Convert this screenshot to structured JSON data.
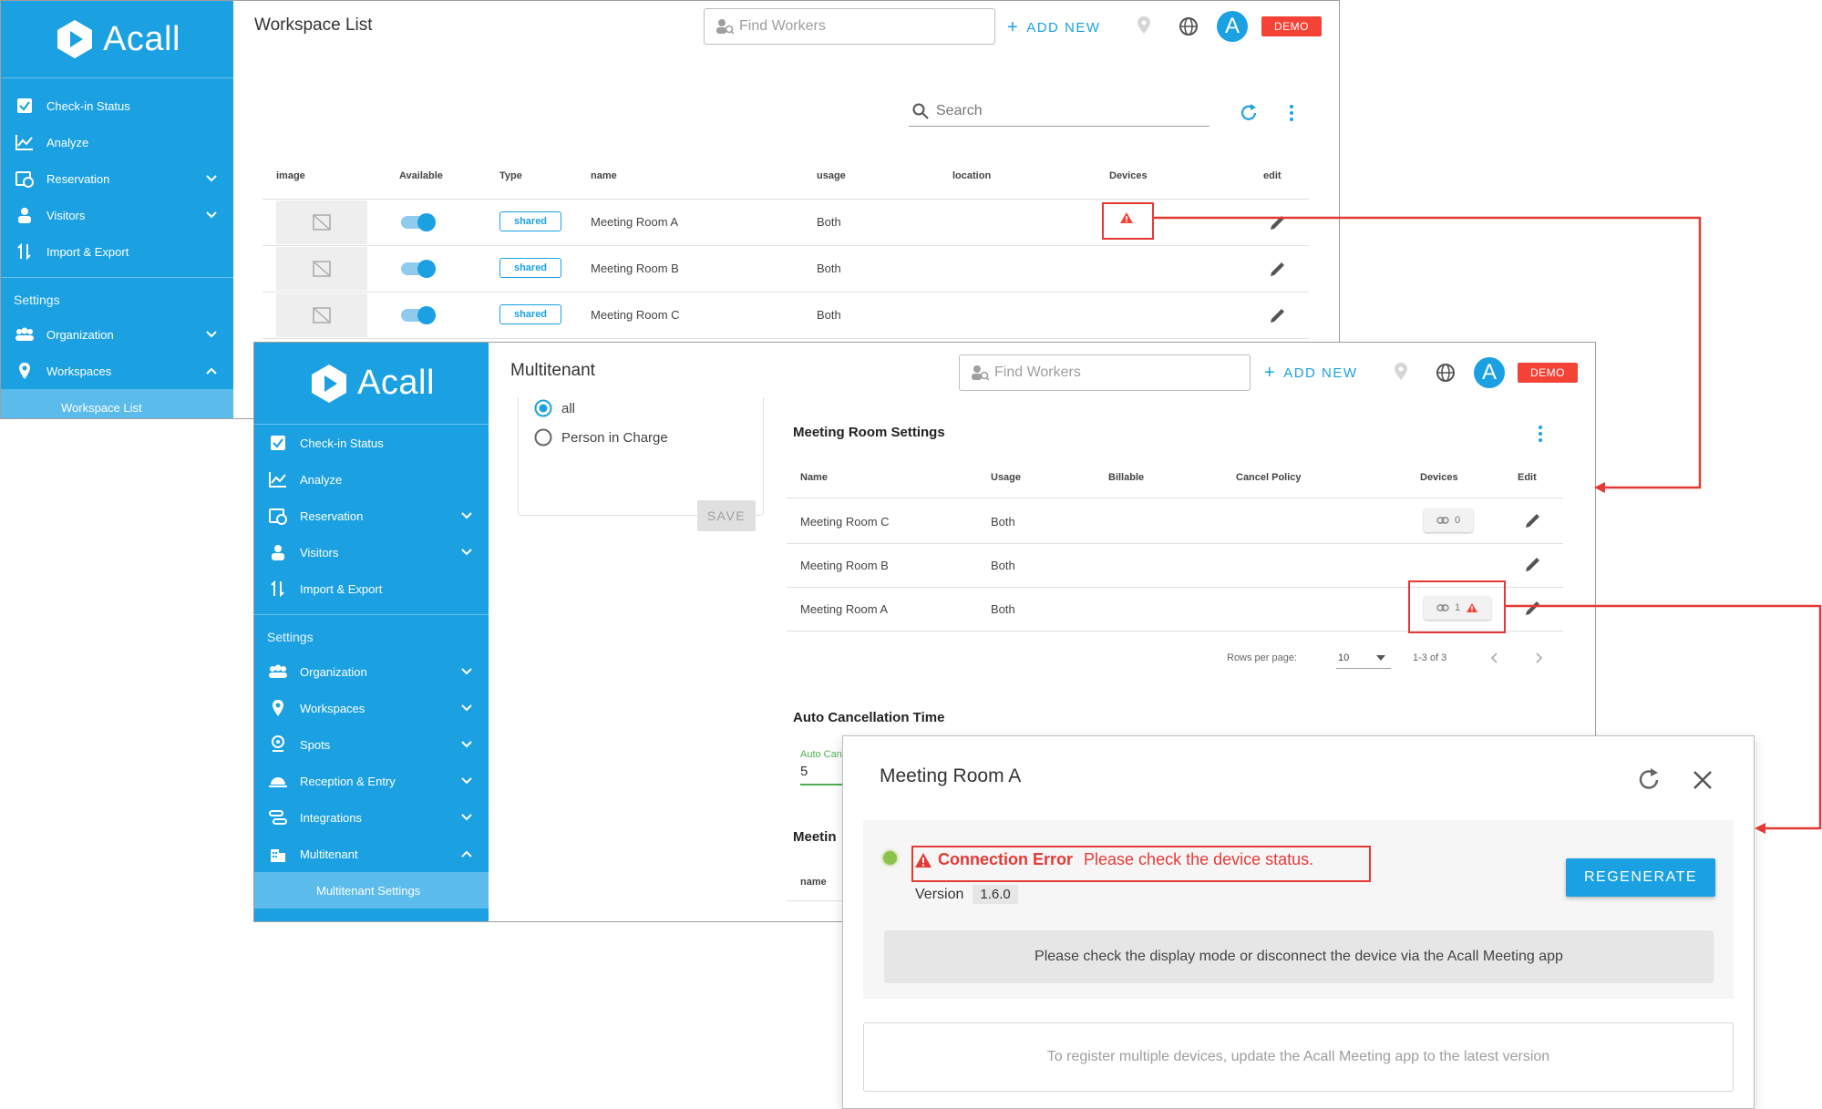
{
  "brand": {
    "name": "Acall"
  },
  "common": {
    "find_placeholder": "Find Workers",
    "add_new": "ADD NEW",
    "avatar_initial": "A",
    "demo_badge": "DEMO",
    "accent": "#1ba1e2",
    "error_color": "#f44336"
  },
  "window1": {
    "title": "Workspace List",
    "search_placeholder": "Search",
    "sidebar": {
      "items": [
        {
          "label": "Check-in Status",
          "icon": "checkbox-icon"
        },
        {
          "label": "Analyze",
          "icon": "chart-line-icon"
        },
        {
          "label": "Reservation",
          "icon": "calendar-clock-icon"
        },
        {
          "label": "Visitors",
          "icon": "visitor-icon"
        },
        {
          "label": "Import & Export",
          "icon": "import-export-icon"
        }
      ],
      "settings_label": "Settings",
      "settings_items": [
        {
          "label": "Organization",
          "icon": "people-icon"
        },
        {
          "label": "Workspaces",
          "icon": "location-pin-icon"
        }
      ],
      "active_sub": "Workspace List"
    },
    "table": {
      "headers": [
        "image",
        "Available",
        "Type",
        "name",
        "usage",
        "location",
        "Devices",
        "edit"
      ],
      "rows": [
        {
          "type": "shared",
          "name": "Meeting Room A",
          "usage": "Both",
          "available": true,
          "device_warning": true
        },
        {
          "type": "shared",
          "name": "Meeting Room B",
          "usage": "Both",
          "available": true,
          "device_warning": false
        },
        {
          "type": "shared",
          "name": "Meeting Room C",
          "usage": "Both",
          "available": true,
          "device_warning": false
        }
      ]
    }
  },
  "window2": {
    "title": "Multitenant",
    "sidebar": {
      "items": [
        {
          "label": "Check-in Status"
        },
        {
          "label": "Analyze"
        },
        {
          "label": "Reservation"
        },
        {
          "label": "Visitors"
        },
        {
          "label": "Import & Export"
        }
      ],
      "settings_label": "Settings",
      "settings_items": [
        {
          "label": "Organization"
        },
        {
          "label": "Workspaces"
        },
        {
          "label": "Spots"
        },
        {
          "label": "Reception & Entry"
        },
        {
          "label": "Integrations"
        },
        {
          "label": "Multitenant"
        }
      ],
      "active_sub": "Multitenant Settings"
    },
    "left_panel": {
      "radio_all": "all",
      "radio_person": "Person in Charge",
      "save": "SAVE"
    },
    "meeting_room_settings": {
      "title": "Meeting Room Settings",
      "headers": [
        "Name",
        "Usage",
        "Billable",
        "Cancel Policy",
        "Devices",
        "Edit"
      ],
      "rows": [
        {
          "name": "Meeting Room C",
          "usage": "Both",
          "devices": "0",
          "device_warning": false
        },
        {
          "name": "Meeting Room B",
          "usage": "Both",
          "devices": "",
          "device_warning": false
        },
        {
          "name": "Meeting Room A",
          "usage": "Both",
          "devices": "1",
          "device_warning": true
        }
      ],
      "rows_per_page_label": "Rows per page:",
      "rows_per_page_value": "10",
      "page_range": "1-3 of 3"
    },
    "auto_cancel": {
      "title": "Auto Cancellation Time",
      "field_label": "Auto Can",
      "value": "5"
    },
    "cut_heading": "Meetin",
    "cut_column": "name"
  },
  "dialog": {
    "title": "Meeting Room A",
    "error_title": "Connection Error",
    "error_message": "Please check the device status.",
    "version_label": "Version",
    "version_value": "1.6.0",
    "regenerate": "REGENERATE",
    "info_message": "Please check the display mode or disconnect the device via the Acall Meeting app",
    "footer_message": "To register multiple devices, update the Acall Meeting app to the latest version"
  }
}
